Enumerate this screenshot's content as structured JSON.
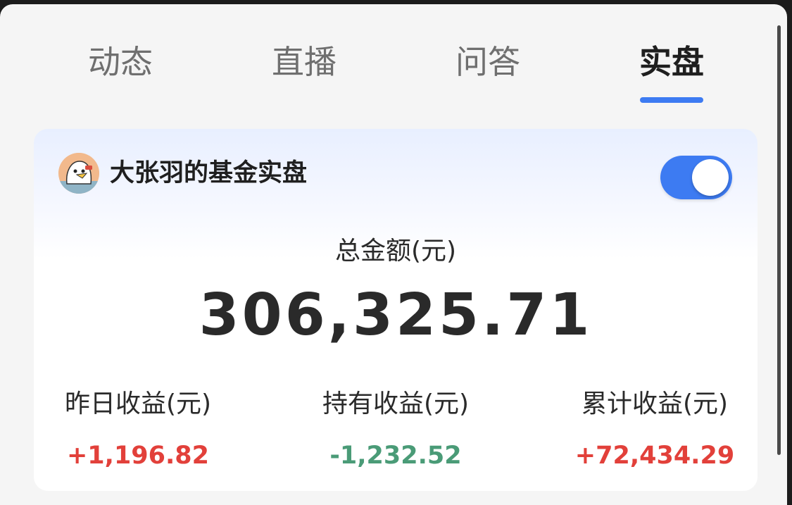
{
  "tabs": [
    {
      "label": "动态"
    },
    {
      "label": "直播"
    },
    {
      "label": "问答"
    },
    {
      "label": "实盘"
    }
  ],
  "active_tab": "实盘",
  "card": {
    "title": "大张羽的基金实盘",
    "toggle_on": true,
    "total": {
      "label": "总金额(元)",
      "value": "306,325.71"
    },
    "stats": [
      {
        "label": "昨日收益(元)",
        "value": "+1,196.82",
        "trend": "positive"
      },
      {
        "label": "持有收益(元)",
        "value": "-1,232.52",
        "trend": "negative"
      },
      {
        "label": "累计收益(元)",
        "value": "+72,434.29",
        "trend": "positive"
      }
    ]
  },
  "colors": {
    "accent": "#3d7bf2",
    "positive": "#e2403a",
    "negative": "#4a9b77"
  },
  "icons": {
    "avatar": "cartoon-duck-avatar"
  }
}
